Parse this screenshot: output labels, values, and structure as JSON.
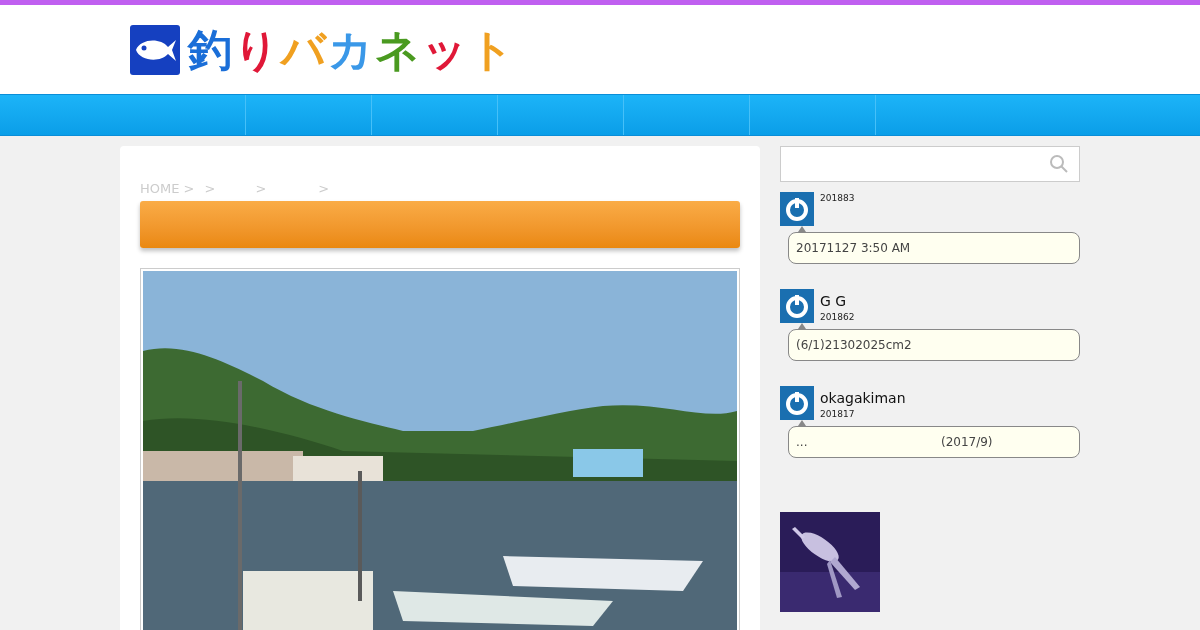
{
  "header": {
    "logo_text": "釣りバカネット"
  },
  "breadcrumb": [
    "HOME >",
    ">",
    ">",
    ">"
  ],
  "sidebar": {
    "comments": [
      {
        "date": "201883",
        "text": "20171127 3:50 AM"
      },
      {
        "author": "G G",
        "date": "201862",
        "text": "(6/1)21302025cm2"
      },
      {
        "author": "okagakiman",
        "date": "201817",
        "text": "...                                   (2017/9)"
      }
    ]
  }
}
